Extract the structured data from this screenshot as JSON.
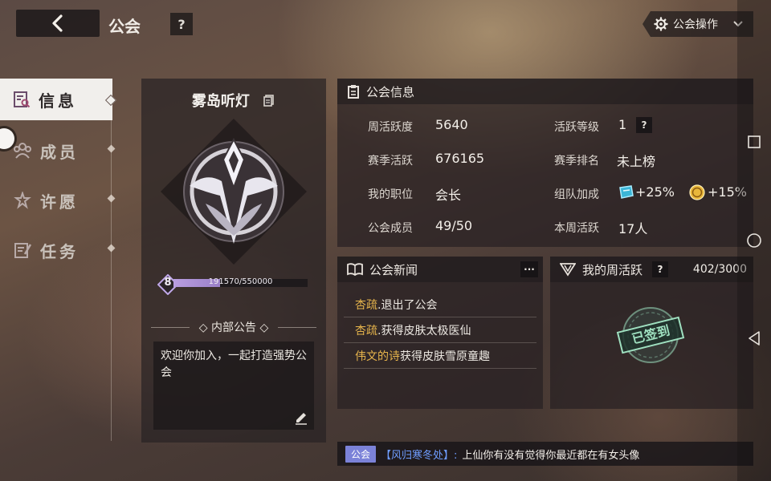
{
  "header": {
    "title": "公会",
    "help_label": "?",
    "ops_label": "公会操作"
  },
  "sidebar": {
    "items": [
      {
        "label": "信息",
        "icon": "info-doc-icon",
        "active": true
      },
      {
        "label": "成员",
        "icon": "members-icon",
        "active": false
      },
      {
        "label": "许愿",
        "icon": "wish-icon",
        "active": false
      },
      {
        "label": "任务",
        "icon": "task-icon",
        "active": false
      }
    ]
  },
  "guild": {
    "name": "雾岛听灯",
    "level": "8",
    "xp_text": "191570/550000",
    "xp_fraction": 0.348,
    "notice_title": "内部公告",
    "notice_text": "欢迎你加入，一起打造强势公会"
  },
  "info": {
    "header": "公会信息",
    "weekly_activity_label": "周活跃度",
    "weekly_activity_value": "5640",
    "season_activity_label": "赛季活跃",
    "season_activity_value": "676165",
    "position_label": "我的职位",
    "position_value": "会长",
    "members_label": "公会成员",
    "members_value": "49/50",
    "activity_level_label": "活跃等级",
    "activity_level_value": "1",
    "activity_level_help": "?",
    "season_rank_label": "赛季排名",
    "season_rank_value": "未上榜",
    "team_bonus_label": "组队加成",
    "team_bonus_1": "+25%",
    "team_bonus_2": "+15%",
    "weekly_active_label": "本周活跃",
    "weekly_active_value": "17人"
  },
  "news": {
    "header": "公会新闻",
    "more_label": "···",
    "items": [
      {
        "name": "杏疏",
        "text": ".退出了公会"
      },
      {
        "name": "杏疏",
        "text": ".获得皮肤太极医仙"
      },
      {
        "name": "伟文的诗",
        "text": "获得皮肤雪原童趣"
      }
    ]
  },
  "weekly": {
    "header": "我的周活跃",
    "help": "?",
    "progress": "402/3000",
    "stamp": "已签到"
  },
  "chat": {
    "channel": "公会",
    "sender": "【风归寒冬处】:",
    "message": "上仙你有没有觉得你最近都在有女头像"
  },
  "colors": {
    "accent_gold": "#e7b54c",
    "xp_purple": "#b99ee0",
    "chat_channel": "#7b82d8",
    "stamp_green": "#9fe0c0"
  }
}
